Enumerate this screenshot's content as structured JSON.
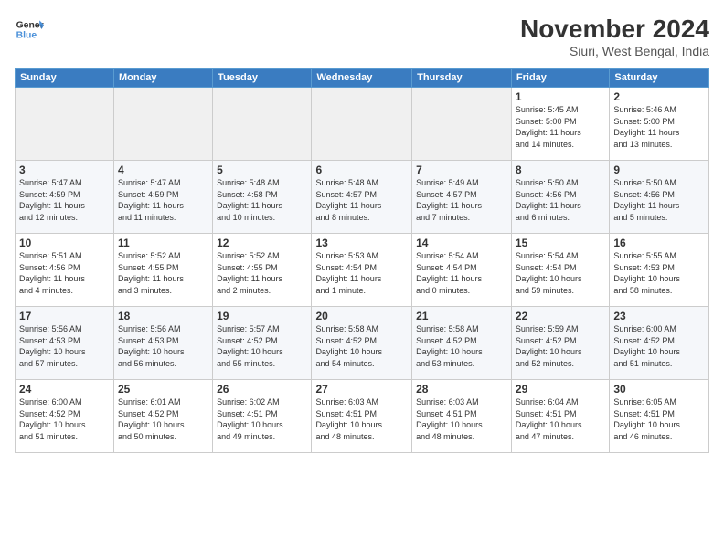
{
  "header": {
    "logo_line1": "General",
    "logo_line2": "Blue",
    "month": "November 2024",
    "location": "Siuri, West Bengal, India"
  },
  "weekdays": [
    "Sunday",
    "Monday",
    "Tuesday",
    "Wednesday",
    "Thursday",
    "Friday",
    "Saturday"
  ],
  "weeks": [
    [
      {
        "day": "",
        "info": ""
      },
      {
        "day": "",
        "info": ""
      },
      {
        "day": "",
        "info": ""
      },
      {
        "day": "",
        "info": ""
      },
      {
        "day": "",
        "info": ""
      },
      {
        "day": "1",
        "info": "Sunrise: 5:45 AM\nSunset: 5:00 PM\nDaylight: 11 hours\nand 14 minutes."
      },
      {
        "day": "2",
        "info": "Sunrise: 5:46 AM\nSunset: 5:00 PM\nDaylight: 11 hours\nand 13 minutes."
      }
    ],
    [
      {
        "day": "3",
        "info": "Sunrise: 5:47 AM\nSunset: 4:59 PM\nDaylight: 11 hours\nand 12 minutes."
      },
      {
        "day": "4",
        "info": "Sunrise: 5:47 AM\nSunset: 4:59 PM\nDaylight: 11 hours\nand 11 minutes."
      },
      {
        "day": "5",
        "info": "Sunrise: 5:48 AM\nSunset: 4:58 PM\nDaylight: 11 hours\nand 10 minutes."
      },
      {
        "day": "6",
        "info": "Sunrise: 5:48 AM\nSunset: 4:57 PM\nDaylight: 11 hours\nand 8 minutes."
      },
      {
        "day": "7",
        "info": "Sunrise: 5:49 AM\nSunset: 4:57 PM\nDaylight: 11 hours\nand 7 minutes."
      },
      {
        "day": "8",
        "info": "Sunrise: 5:50 AM\nSunset: 4:56 PM\nDaylight: 11 hours\nand 6 minutes."
      },
      {
        "day": "9",
        "info": "Sunrise: 5:50 AM\nSunset: 4:56 PM\nDaylight: 11 hours\nand 5 minutes."
      }
    ],
    [
      {
        "day": "10",
        "info": "Sunrise: 5:51 AM\nSunset: 4:56 PM\nDaylight: 11 hours\nand 4 minutes."
      },
      {
        "day": "11",
        "info": "Sunrise: 5:52 AM\nSunset: 4:55 PM\nDaylight: 11 hours\nand 3 minutes."
      },
      {
        "day": "12",
        "info": "Sunrise: 5:52 AM\nSunset: 4:55 PM\nDaylight: 11 hours\nand 2 minutes."
      },
      {
        "day": "13",
        "info": "Sunrise: 5:53 AM\nSunset: 4:54 PM\nDaylight: 11 hours\nand 1 minute."
      },
      {
        "day": "14",
        "info": "Sunrise: 5:54 AM\nSunset: 4:54 PM\nDaylight: 11 hours\nand 0 minutes."
      },
      {
        "day": "15",
        "info": "Sunrise: 5:54 AM\nSunset: 4:54 PM\nDaylight: 10 hours\nand 59 minutes."
      },
      {
        "day": "16",
        "info": "Sunrise: 5:55 AM\nSunset: 4:53 PM\nDaylight: 10 hours\nand 58 minutes."
      }
    ],
    [
      {
        "day": "17",
        "info": "Sunrise: 5:56 AM\nSunset: 4:53 PM\nDaylight: 10 hours\nand 57 minutes."
      },
      {
        "day": "18",
        "info": "Sunrise: 5:56 AM\nSunset: 4:53 PM\nDaylight: 10 hours\nand 56 minutes."
      },
      {
        "day": "19",
        "info": "Sunrise: 5:57 AM\nSunset: 4:52 PM\nDaylight: 10 hours\nand 55 minutes."
      },
      {
        "day": "20",
        "info": "Sunrise: 5:58 AM\nSunset: 4:52 PM\nDaylight: 10 hours\nand 54 minutes."
      },
      {
        "day": "21",
        "info": "Sunrise: 5:58 AM\nSunset: 4:52 PM\nDaylight: 10 hours\nand 53 minutes."
      },
      {
        "day": "22",
        "info": "Sunrise: 5:59 AM\nSunset: 4:52 PM\nDaylight: 10 hours\nand 52 minutes."
      },
      {
        "day": "23",
        "info": "Sunrise: 6:00 AM\nSunset: 4:52 PM\nDaylight: 10 hours\nand 51 minutes."
      }
    ],
    [
      {
        "day": "24",
        "info": "Sunrise: 6:00 AM\nSunset: 4:52 PM\nDaylight: 10 hours\nand 51 minutes."
      },
      {
        "day": "25",
        "info": "Sunrise: 6:01 AM\nSunset: 4:52 PM\nDaylight: 10 hours\nand 50 minutes."
      },
      {
        "day": "26",
        "info": "Sunrise: 6:02 AM\nSunset: 4:51 PM\nDaylight: 10 hours\nand 49 minutes."
      },
      {
        "day": "27",
        "info": "Sunrise: 6:03 AM\nSunset: 4:51 PM\nDaylight: 10 hours\nand 48 minutes."
      },
      {
        "day": "28",
        "info": "Sunrise: 6:03 AM\nSunset: 4:51 PM\nDaylight: 10 hours\nand 48 minutes."
      },
      {
        "day": "29",
        "info": "Sunrise: 6:04 AM\nSunset: 4:51 PM\nDaylight: 10 hours\nand 47 minutes."
      },
      {
        "day": "30",
        "info": "Sunrise: 6:05 AM\nSunset: 4:51 PM\nDaylight: 10 hours\nand 46 minutes."
      }
    ]
  ]
}
